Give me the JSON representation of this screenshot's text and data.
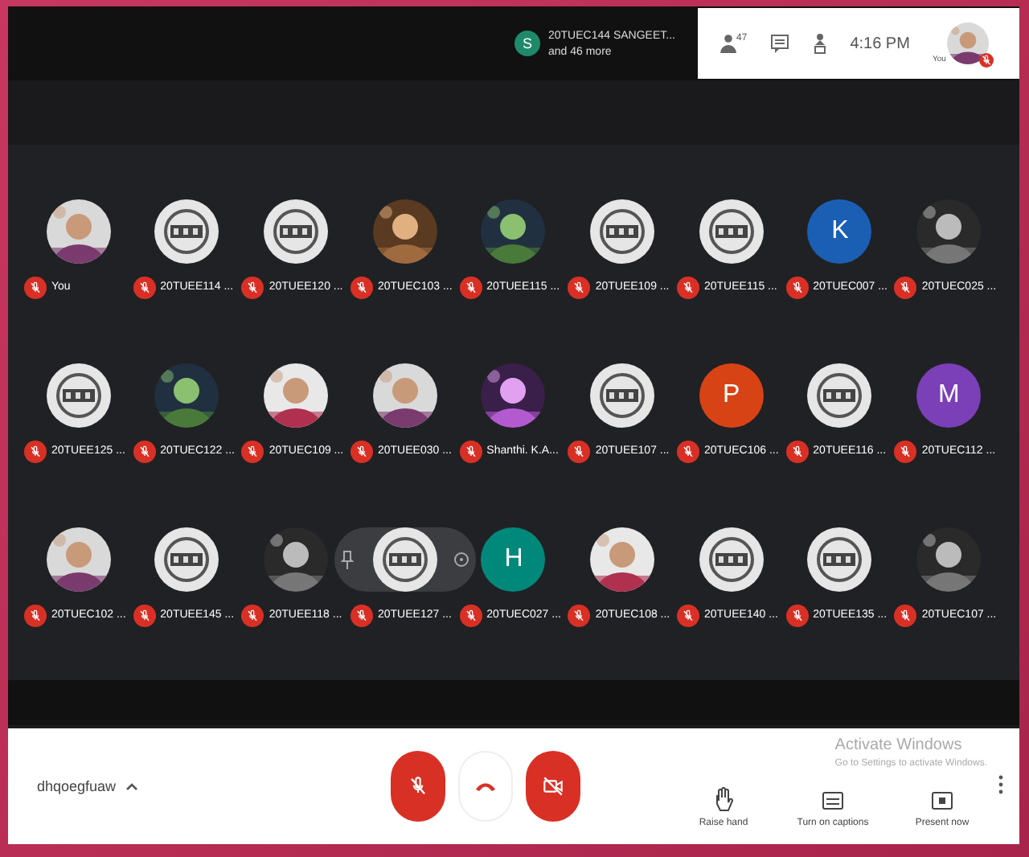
{
  "header": {
    "speaker": {
      "initial": "S",
      "name": "20TUEC144 SANGEET...",
      "more": "and 46 more"
    },
    "participant_count": "47",
    "time": "4:16 PM",
    "self_label": "You",
    "self_muted": true
  },
  "participants": [
    {
      "name": "You",
      "kind": "picture",
      "muted": true,
      "hovered": false
    },
    {
      "name": "20TUEE114 ...",
      "kind": "logo",
      "muted": true,
      "hovered": false
    },
    {
      "name": "20TUEE120 ...",
      "kind": "logo",
      "muted": true,
      "hovered": false
    },
    {
      "name": "20TUEC103 ...",
      "kind": "picture",
      "muted": true,
      "hovered": false
    },
    {
      "name": "20TUEE115 ...",
      "kind": "picture",
      "muted": true,
      "hovered": false
    },
    {
      "name": "20TUEE109 ...",
      "kind": "logo",
      "muted": true,
      "hovered": false
    },
    {
      "name": "20TUEE115 ...",
      "kind": "logo",
      "muted": true,
      "hovered": false
    },
    {
      "name": "20TUEC007 ...",
      "kind": "letter",
      "letter": "K",
      "color": "#1a5fb4",
      "muted": true,
      "hovered": false
    },
    {
      "name": "20TUEC025 ...",
      "kind": "picture",
      "muted": true,
      "hovered": false
    },
    {
      "name": "20TUEE125 ...",
      "kind": "logo",
      "muted": true,
      "hovered": false
    },
    {
      "name": "20TUEC122 ...",
      "kind": "picture",
      "muted": true,
      "hovered": false
    },
    {
      "name": "20TUEC109 ...",
      "kind": "picture",
      "muted": true,
      "hovered": false
    },
    {
      "name": "20TUEE030 ...",
      "kind": "picture",
      "muted": true,
      "hovered": false
    },
    {
      "name": "Shanthi. K.A...",
      "kind": "picture",
      "muted": true,
      "hovered": false
    },
    {
      "name": "20TUEE107 ...",
      "kind": "logo",
      "muted": true,
      "hovered": false
    },
    {
      "name": "20TUEC106 ...",
      "kind": "letter",
      "letter": "P",
      "color": "#d84315",
      "muted": true,
      "hovered": false
    },
    {
      "name": "20TUEE116 ...",
      "kind": "logo",
      "muted": true,
      "hovered": false
    },
    {
      "name": "20TUEC112 ...",
      "kind": "letter",
      "letter": "M",
      "color": "#7b3fb8",
      "muted": true,
      "hovered": false
    },
    {
      "name": "20TUEC102 ...",
      "kind": "picture",
      "muted": true,
      "hovered": false
    },
    {
      "name": "20TUEE145 ...",
      "kind": "logo",
      "muted": true,
      "hovered": false
    },
    {
      "name": "20TUEE118 ...",
      "kind": "picture",
      "muted": true,
      "hovered": false
    },
    {
      "name": "20TUEE127 ...",
      "kind": "logo",
      "muted": true,
      "hovered": true
    },
    {
      "name": "20TUEC027 ...",
      "kind": "letter",
      "letter": "H",
      "color": "#00897b",
      "muted": true,
      "hovered": false
    },
    {
      "name": "20TUEC108 ...",
      "kind": "picture",
      "muted": true,
      "hovered": false
    },
    {
      "name": "20TUEE140 ...",
      "kind": "logo",
      "muted": true,
      "hovered": false
    },
    {
      "name": "20TUEE135 ...",
      "kind": "logo",
      "muted": true,
      "hovered": false
    },
    {
      "name": "20TUEC107 ...",
      "kind": "picture",
      "muted": true,
      "hovered": false
    }
  ],
  "bottom_bar": {
    "meeting_code": "dhqoegfuaw",
    "mic_on": false,
    "camera_on": false,
    "actions": [
      {
        "label": "Raise hand",
        "kind": "hand"
      },
      {
        "label": "Turn on captions",
        "kind": "captions"
      },
      {
        "label": "Present now",
        "kind": "present"
      }
    ]
  },
  "os_notice": {
    "title": "Activate Windows",
    "text": "Go to Settings to activate Windows."
  }
}
